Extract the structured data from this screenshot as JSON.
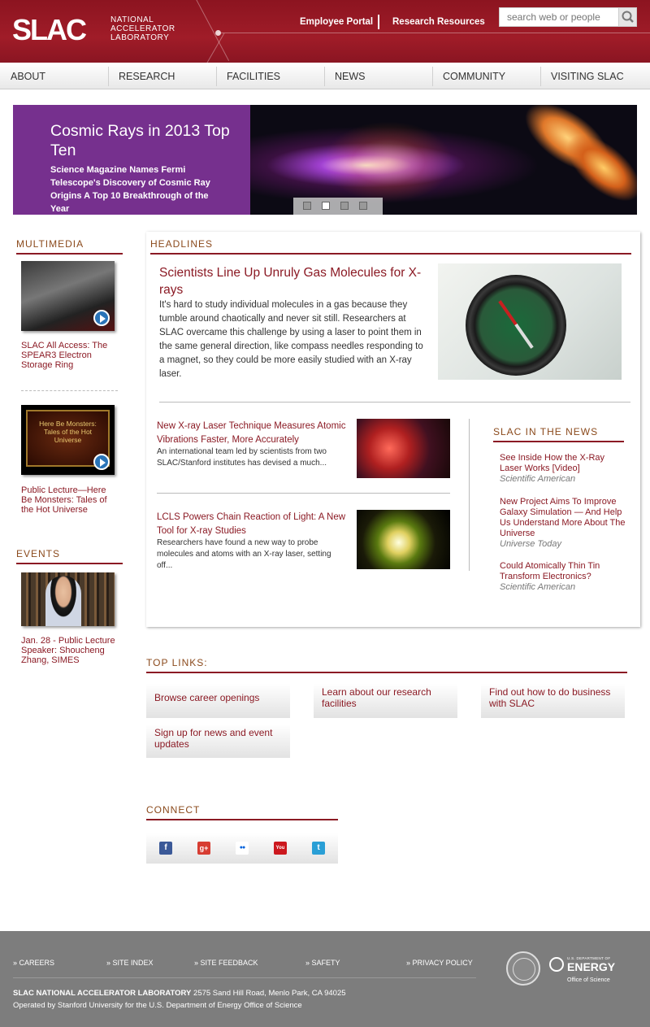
{
  "header": {
    "logo_text": "SLAC",
    "logo_sub": [
      "NATIONAL",
      "ACCELERATOR",
      "LABORATORY"
    ],
    "links": [
      "Employee Portal",
      "Research Resources"
    ],
    "search_placeholder": "search web or people",
    "brand_color": "#a01c28"
  },
  "nav": [
    "ABOUT",
    "RESEARCH",
    "FACILITIES",
    "NEWS",
    "COMMUNITY",
    "VISITING SLAC"
  ],
  "hero": {
    "title": "Cosmic Rays in 2013 Top Ten",
    "description": "Science Magazine Names Fermi Telescope's Discovery of Cosmic Ray Origins A Top 10 Breakthrough of the Year",
    "background_color": "#76308e",
    "slide_count": 4,
    "active_slide": 2
  },
  "multimedia": {
    "heading": "MULTIMEDIA",
    "items": [
      {
        "label": "SLAC All Access: The SPEAR3 Electron Storage Ring",
        "icon": "play-icon"
      },
      {
        "label": "Public Lecture—Here Be Monsters: Tales of the Hot Universe",
        "image_text": "Here Be Monsters: Tales of the Hot Universe",
        "icon": "play-icon"
      }
    ]
  },
  "events": {
    "heading": "EVENTS",
    "items": [
      {
        "label": "Jan. 28 - Public Lecture Speaker: Shoucheng Zhang, SIMES"
      }
    ]
  },
  "headlines": {
    "heading": "HEADLINES",
    "main": {
      "title": "Scientists Line Up Unruly Gas Molecules for X-rays",
      "text": "It's hard to study individual molecules in a gas because they tumble around chaotically and never sit still. Researchers at SLAC overcame this challenge by using a laser to point them in the same general direction, like compass needles responding to a magnet, so they could be more easily studied with an X-ray laser."
    },
    "items": [
      {
        "title": "New X-ray Laser Technique Measures Atomic Vibrations Faster, More Accurately",
        "text": "An international team led by scientists from two SLAC/Stanford institutes has devised a much..."
      },
      {
        "title": "LCLS Powers Chain Reaction of Light: A New Tool for X-ray Studies",
        "text": "Researchers have found a new way to probe molecules and atoms with an X-ray laser, setting off..."
      }
    ]
  },
  "in_the_news": {
    "heading": "SLAC IN THE NEWS",
    "items": [
      {
        "title": "See Inside How the X-Ray Laser Works [Video]",
        "source": "Scientific American"
      },
      {
        "title": "New Project Aims To Improve Galaxy Simulation — And Help Us Understand More About The Universe",
        "source": "Universe Today"
      },
      {
        "title": "Could Atomically Thin Tin Transform Electronics?",
        "source": "Scientific American"
      }
    ]
  },
  "top_links": {
    "heading": "TOP LINKS:",
    "items": [
      "Browse career openings",
      "Learn about our research facilities",
      "Find out how to do business with SLAC",
      "Sign up for news and event updates"
    ]
  },
  "connect": {
    "heading": "CONNECT",
    "icons": [
      {
        "name": "facebook-icon",
        "glyph": "f",
        "color": "#3b5998"
      },
      {
        "name": "google-plus-icon",
        "glyph": "g+",
        "color": "#d73d32"
      },
      {
        "name": "flickr-icon",
        "glyph": "●●",
        "color": "#ffffff"
      },
      {
        "name": "youtube-icon",
        "glyph": "You",
        "color": "#cc181e"
      },
      {
        "name": "twitter-icon",
        "glyph": "t",
        "color": "#2a9fd6"
      }
    ]
  },
  "footer": {
    "links": [
      "» CAREERS",
      "» SITE INDEX",
      "» SITE FEEDBACK",
      "» SAFETY",
      "» PRIVACY POLICY"
    ],
    "address_bold": "SLAC NATIONAL ACCELERATOR LABORATORY",
    "address": " 2575 Sand Hill Road, Menlo Park, CA 94025",
    "operated": "Operated by Stanford University for the U.S. Department of Energy Office of Science",
    "doe_small": "U.S. DEPARTMENT OF",
    "doe_big": "ENERGY",
    "doe_office": "Office of Science"
  }
}
